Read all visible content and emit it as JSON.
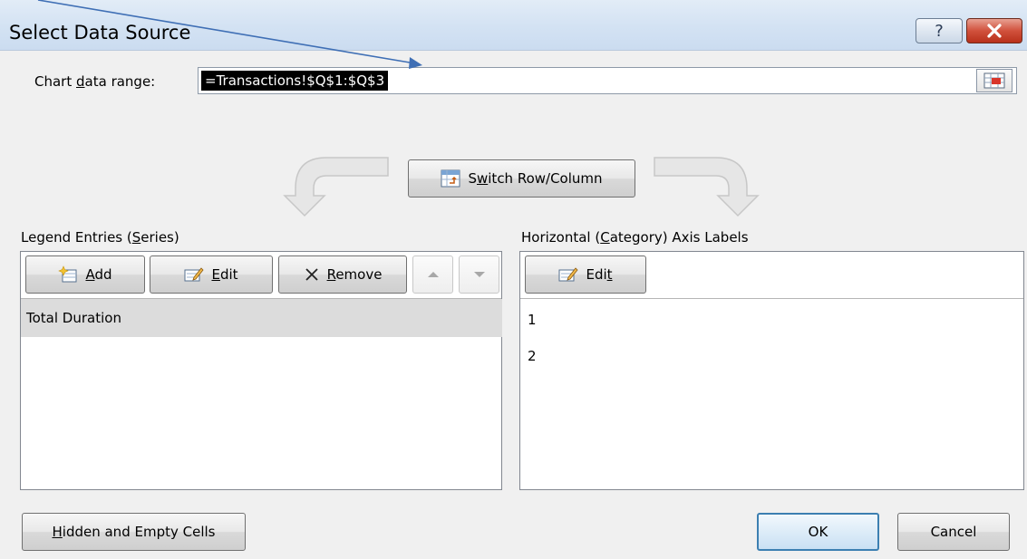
{
  "window": {
    "title": "Select Data Source",
    "help_label": "?",
    "close_label": "✕"
  },
  "range": {
    "label_pre": "Chart ",
    "label_u": "d",
    "label_post": "ata range:",
    "value": "=Transactions!$Q$1:$Q$3"
  },
  "switch": {
    "pre": "S",
    "u": "w",
    "post": "itch Row/Column"
  },
  "legend": {
    "label_pre": "Legend Entries (",
    "label_u": "S",
    "label_post": "eries)",
    "add_u": "A",
    "add_post": "dd",
    "edit_u": "E",
    "edit_post": "dit",
    "remove_u": "R",
    "remove_post": "emove",
    "items": [
      "Total Duration"
    ]
  },
  "category": {
    "label_pre": "Horizontal (",
    "label_u": "C",
    "label_post": "ategory) Axis Labels",
    "edit_pre": "Edi",
    "edit_u": "t",
    "items": [
      "1",
      "2"
    ]
  },
  "footer": {
    "hidden_u": "H",
    "hidden_post": "idden and Empty Cells",
    "ok_label": "OK",
    "cancel_label": "Cancel"
  },
  "colors": {
    "pointer_arrow": "#3f6fb5",
    "ok_border": "#3c7fb1",
    "close_red": "#c8402a"
  }
}
